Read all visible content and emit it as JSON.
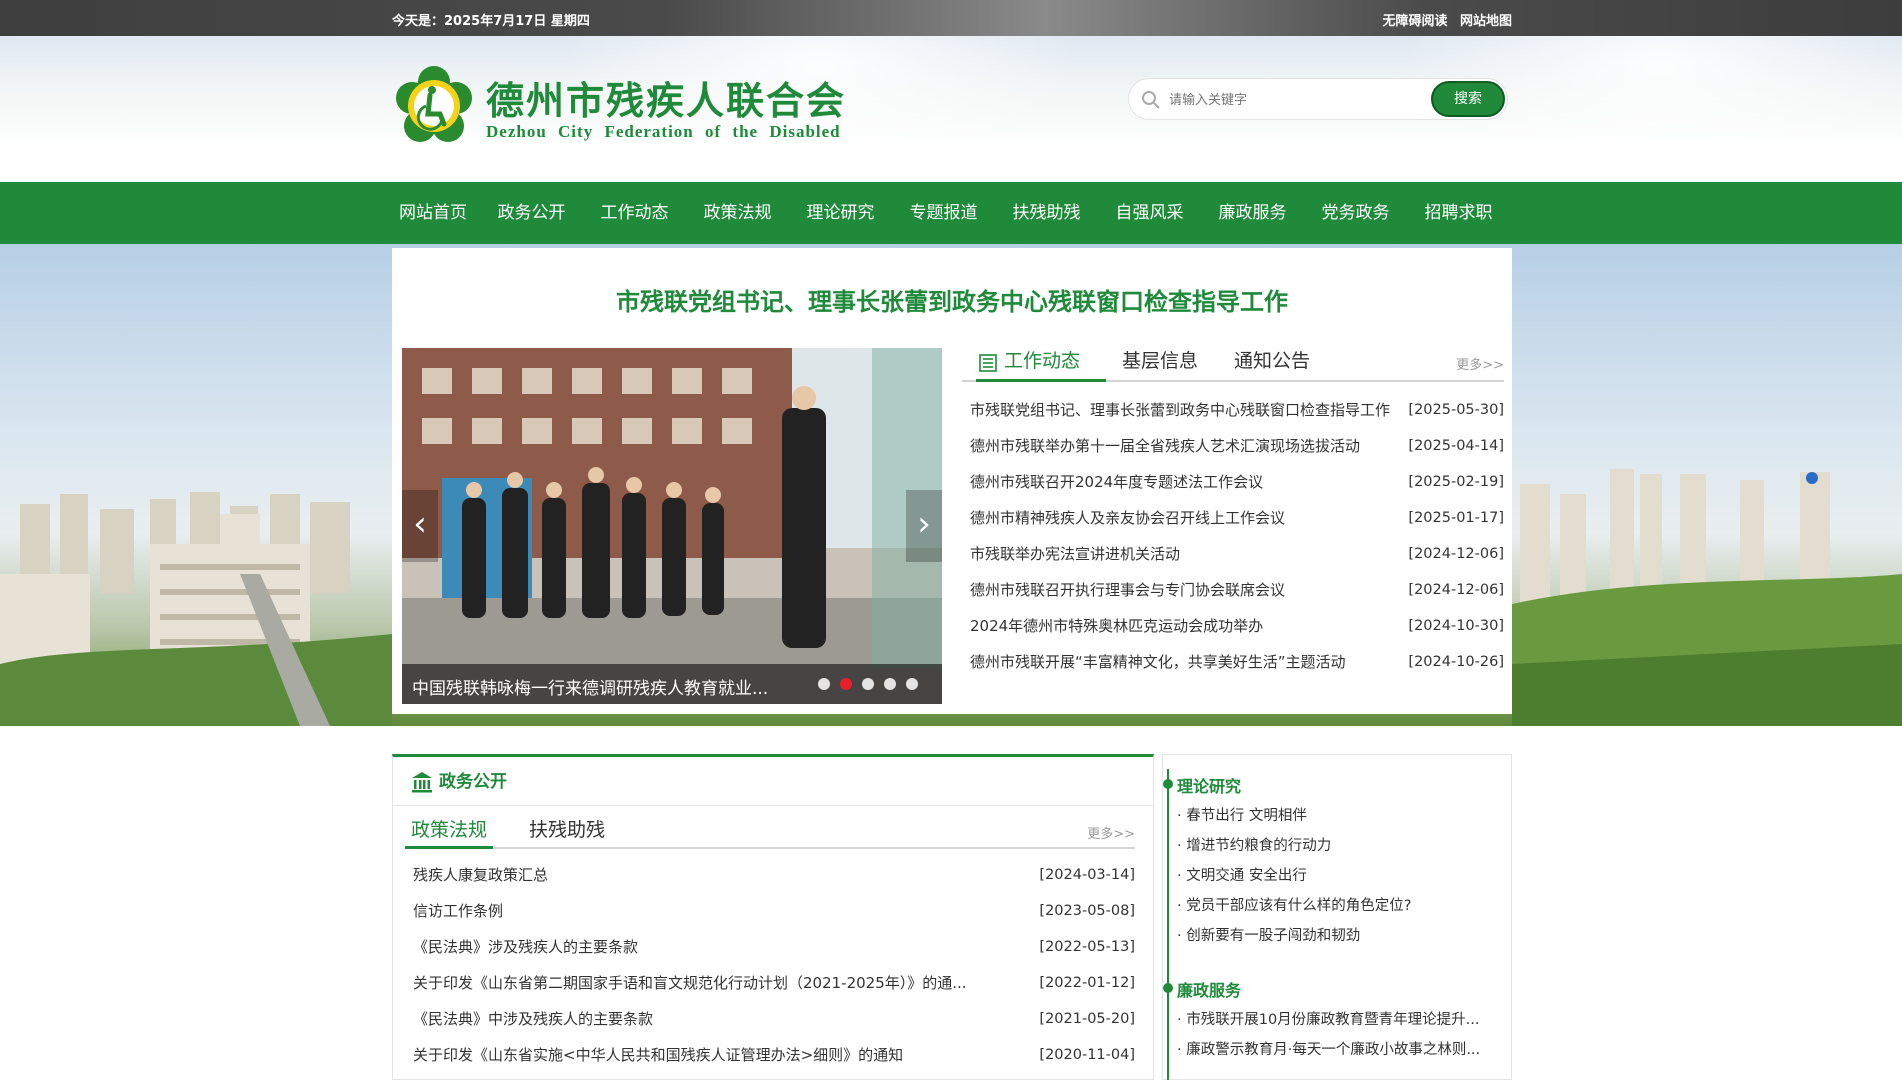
{
  "topbar": {
    "date_label": "今天是：",
    "date_value": "2025年7月17日 星期四",
    "accessible_read": "无障碍阅读",
    "sitemap": "网站地图"
  },
  "header": {
    "title_cn": "德州市残疾人联合会",
    "title_en": "Dezhou City Federation of the Disabled",
    "search_placeholder": "请输入关键字",
    "search_button": "搜索"
  },
  "nav": {
    "items": [
      "网站首页",
      "政务公开",
      "工作动态",
      "政策法规",
      "理论研究",
      "专题报道",
      "扶残助残",
      "自强风采",
      "廉政服务",
      "党务政务",
      "招聘求职"
    ]
  },
  "headline": "市残联党组书记、理事长张蕾到政务中心残联窗口检查指导工作",
  "slider": {
    "caption": "中国残联韩咏梅一行来德调研残疾人教育就业...",
    "prev": "‹",
    "next": "›",
    "active_dot": 2,
    "dot_count": 5
  },
  "news_panel": {
    "tabs": [
      "工作动态",
      "基层信息",
      "通知公告"
    ],
    "more": "更多>>",
    "items": [
      {
        "title": "市残联党组书记、理事长张蕾到政务中心残联窗口检查指导工作",
        "date": "[2025-05-30]"
      },
      {
        "title": "德州市残联举办第十一届全省残疾人艺术汇演现场选拔活动",
        "date": "[2025-04-14]"
      },
      {
        "title": "德州市残联召开2024年度专题述法工作会议",
        "date": "[2025-02-19]"
      },
      {
        "title": "德州市精神残疾人及亲友协会召开线上工作会议",
        "date": "[2025-01-17]"
      },
      {
        "title": "市残联举办宪法宣讲进机关活动",
        "date": "[2024-12-06]"
      },
      {
        "title": "德州市残联召开执行理事会与专门协会联席会议",
        "date": "[2024-12-06]"
      },
      {
        "title": "2024年德州市特殊奥林匹克运动会成功举办",
        "date": "[2024-10-30]"
      },
      {
        "title": "德州市残联开展“丰富精神文化，共享美好生活”主题活动",
        "date": "[2024-10-26]"
      }
    ]
  },
  "zwgk": {
    "title": "政务公开",
    "tabs": [
      "政策法规",
      "扶残助残"
    ],
    "more": "更多>>",
    "items": [
      {
        "title": "残疾人康复政策汇总",
        "date": "[2024-03-14]"
      },
      {
        "title": "信访工作条例",
        "date": "[2023-05-08]"
      },
      {
        "title": "《民法典》涉及残疾人的主要条款",
        "date": "[2022-05-13]"
      },
      {
        "title": "关于印发《山东省第二期国家手语和盲文规范化行动计划（2021-2025年）》的通...",
        "date": "[2022-01-12]"
      },
      {
        "title": "《民法典》中涉及残疾人的主要条款",
        "date": "[2021-05-20]"
      },
      {
        "title": "关于印发《山东省实施<中华人民共和国残疾人证管理办法>细则》的通知",
        "date": "[2020-11-04]"
      }
    ]
  },
  "right": {
    "sections": [
      {
        "title": "理论研究",
        "items": [
          "春节出行 文明相伴",
          "增进节约粮食的行动力",
          "文明交通 安全出行",
          "党员干部应该有什么样的角色定位?",
          "创新要有一股子闯劲和韧劲"
        ]
      },
      {
        "title": "廉政服务",
        "items": [
          "市残联开展10月份廉政教育暨青年理论提升...",
          "廉政警示教育月·每天一个廉政小故事之林则..."
        ]
      }
    ]
  },
  "colors": {
    "brand_green": "#1f8a3a",
    "active_dot": "#e5202a"
  }
}
